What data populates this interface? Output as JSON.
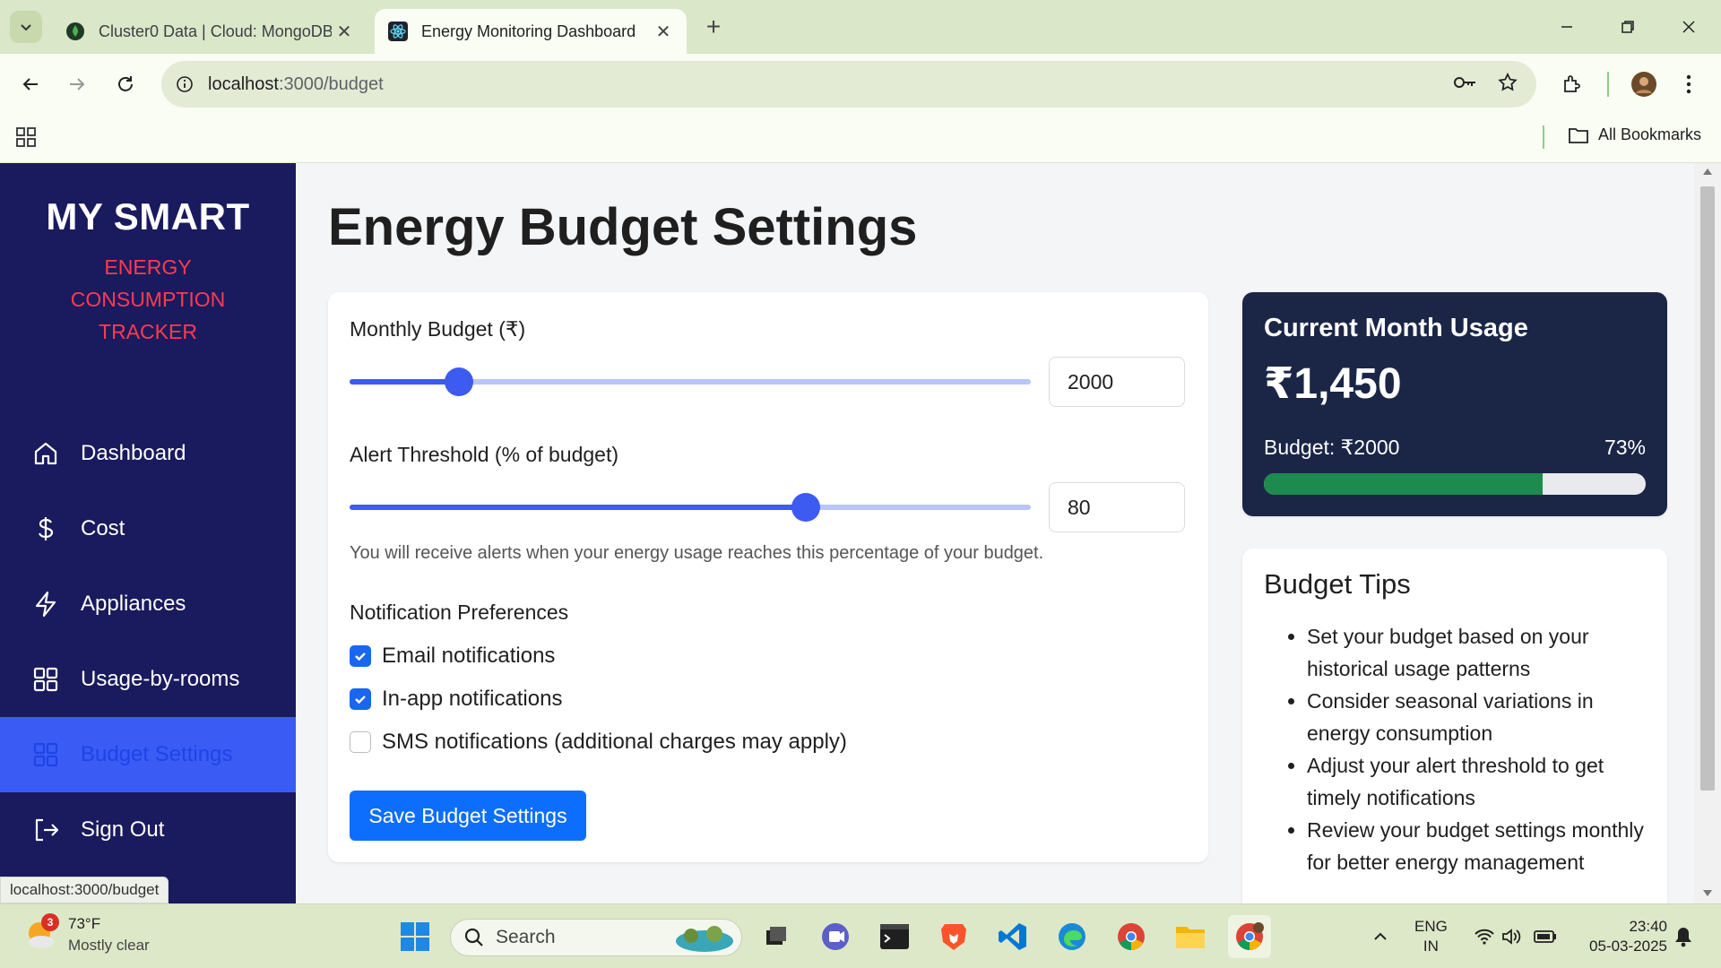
{
  "browser": {
    "tabs": [
      {
        "title": "Cluster0 Data | Cloud: MongoDB",
        "active": false
      },
      {
        "title": "Energy Monitoring Dashboard",
        "active": true
      }
    ],
    "url_host": "localhost",
    "url_path": ":3000/budget",
    "bookmarks_label": "All Bookmarks",
    "status_url": "localhost:3000/budget"
  },
  "sidebar": {
    "brand_main": "MY SMART",
    "brand_sub_lines": [
      "ENERGY",
      "CONSUMPTION",
      "TRACKER"
    ],
    "items": [
      {
        "label": "Dashboard",
        "icon": "home-icon"
      },
      {
        "label": "Cost",
        "icon": "dollar-icon"
      },
      {
        "label": "Appliances",
        "icon": "lightning-icon"
      },
      {
        "label": "Usage-by-rooms",
        "icon": "grid-icon"
      },
      {
        "label": "Budget Settings",
        "icon": "grid-icon",
        "active": true
      },
      {
        "label": "Sign Out",
        "icon": "sign-out-icon"
      }
    ]
  },
  "page": {
    "title": "Energy Budget Settings"
  },
  "settings": {
    "monthly_budget_label": "Monthly Budget (₹)",
    "monthly_budget_value": "2000",
    "monthly_budget_fraction": 0.16,
    "alert_label": "Alert Threshold (% of budget)",
    "alert_value": "80",
    "alert_fraction": 0.67,
    "alert_hint": "You will receive alerts when your energy usage reaches this percentage of your budget.",
    "notifications_heading": "Notification Preferences",
    "notifications": [
      {
        "label": "Email notifications",
        "checked": true
      },
      {
        "label": "In-app notifications",
        "checked": true
      },
      {
        "label": "SMS notifications (additional charges may apply)",
        "checked": false
      }
    ],
    "save_label": "Save Budget Settings"
  },
  "usage": {
    "title": "Current Month Usage",
    "amount": "₹1,450",
    "budget_text": "Budget: ₹2000",
    "percent_text": "73%",
    "percent": 73,
    "bar_color": "#1d8a4e"
  },
  "tips": {
    "title": "Budget Tips",
    "items": [
      "Set your budget based on your historical usage patterns",
      "Consider seasonal variations in energy consumption",
      "Adjust your alert threshold to get timely notifications",
      "Review your budget settings monthly for better energy management"
    ]
  },
  "taskbar": {
    "weather_temp": "73°F",
    "weather_desc": "Mostly clear",
    "weather_badge": "3",
    "search_placeholder": "Search",
    "lang_top": "ENG",
    "lang_bottom": "IN",
    "time": "23:40",
    "date": "05-03-2025"
  },
  "colors": {
    "sidebar_bg": "#1a1a5e",
    "brand_accent": "#ff3b4e",
    "active_nav_bg": "#3a5cf5",
    "primary": "#0d6efd",
    "usage_card_bg": "#1b2647"
  }
}
